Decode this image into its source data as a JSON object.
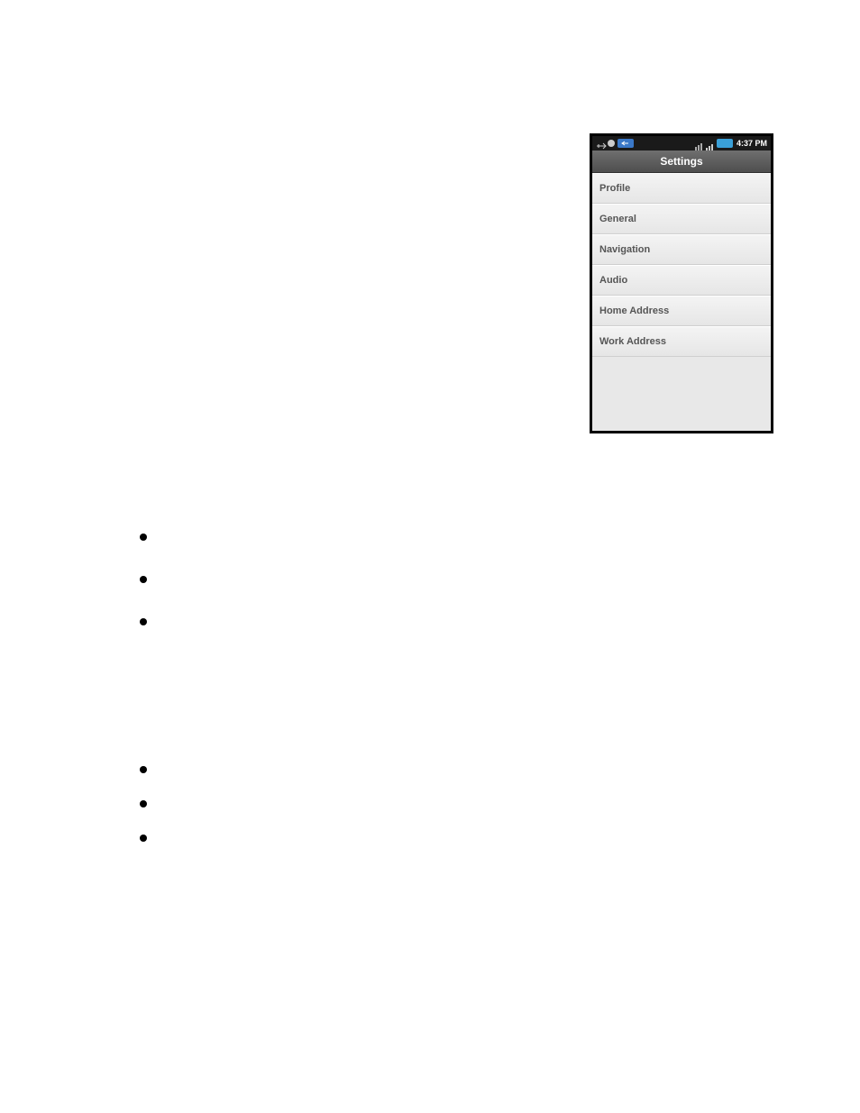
{
  "status_bar": {
    "time": "4:37 PM"
  },
  "title": "Settings",
  "menu": [
    {
      "label": "Profile"
    },
    {
      "label": "General"
    },
    {
      "label": "Navigation"
    },
    {
      "label": "Audio"
    },
    {
      "label": "Home Address"
    },
    {
      "label": "Work Address"
    }
  ]
}
